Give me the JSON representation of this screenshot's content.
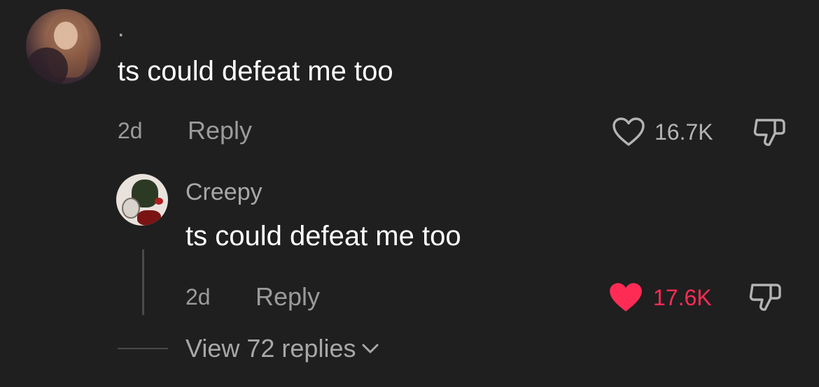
{
  "comment": {
    "username": ".",
    "text": "ts could defeat me too",
    "time": "2d",
    "reply_label": "Reply",
    "like_count": "16.7K",
    "liked": false
  },
  "reply": {
    "username": "Creepy",
    "text": "ts could defeat me too",
    "time": "2d",
    "reply_label": "Reply",
    "like_count": "17.6K",
    "liked": true
  },
  "view_replies_label": "View 72 replies",
  "colors": {
    "background": "#1f1f1f",
    "liked": "#fe2c55",
    "muted": "#9b9b9b"
  },
  "icons": {
    "like": "heart-outline-icon",
    "liked": "heart-filled-icon",
    "dislike": "thumbs-down-icon",
    "expand": "chevron-down-icon"
  }
}
